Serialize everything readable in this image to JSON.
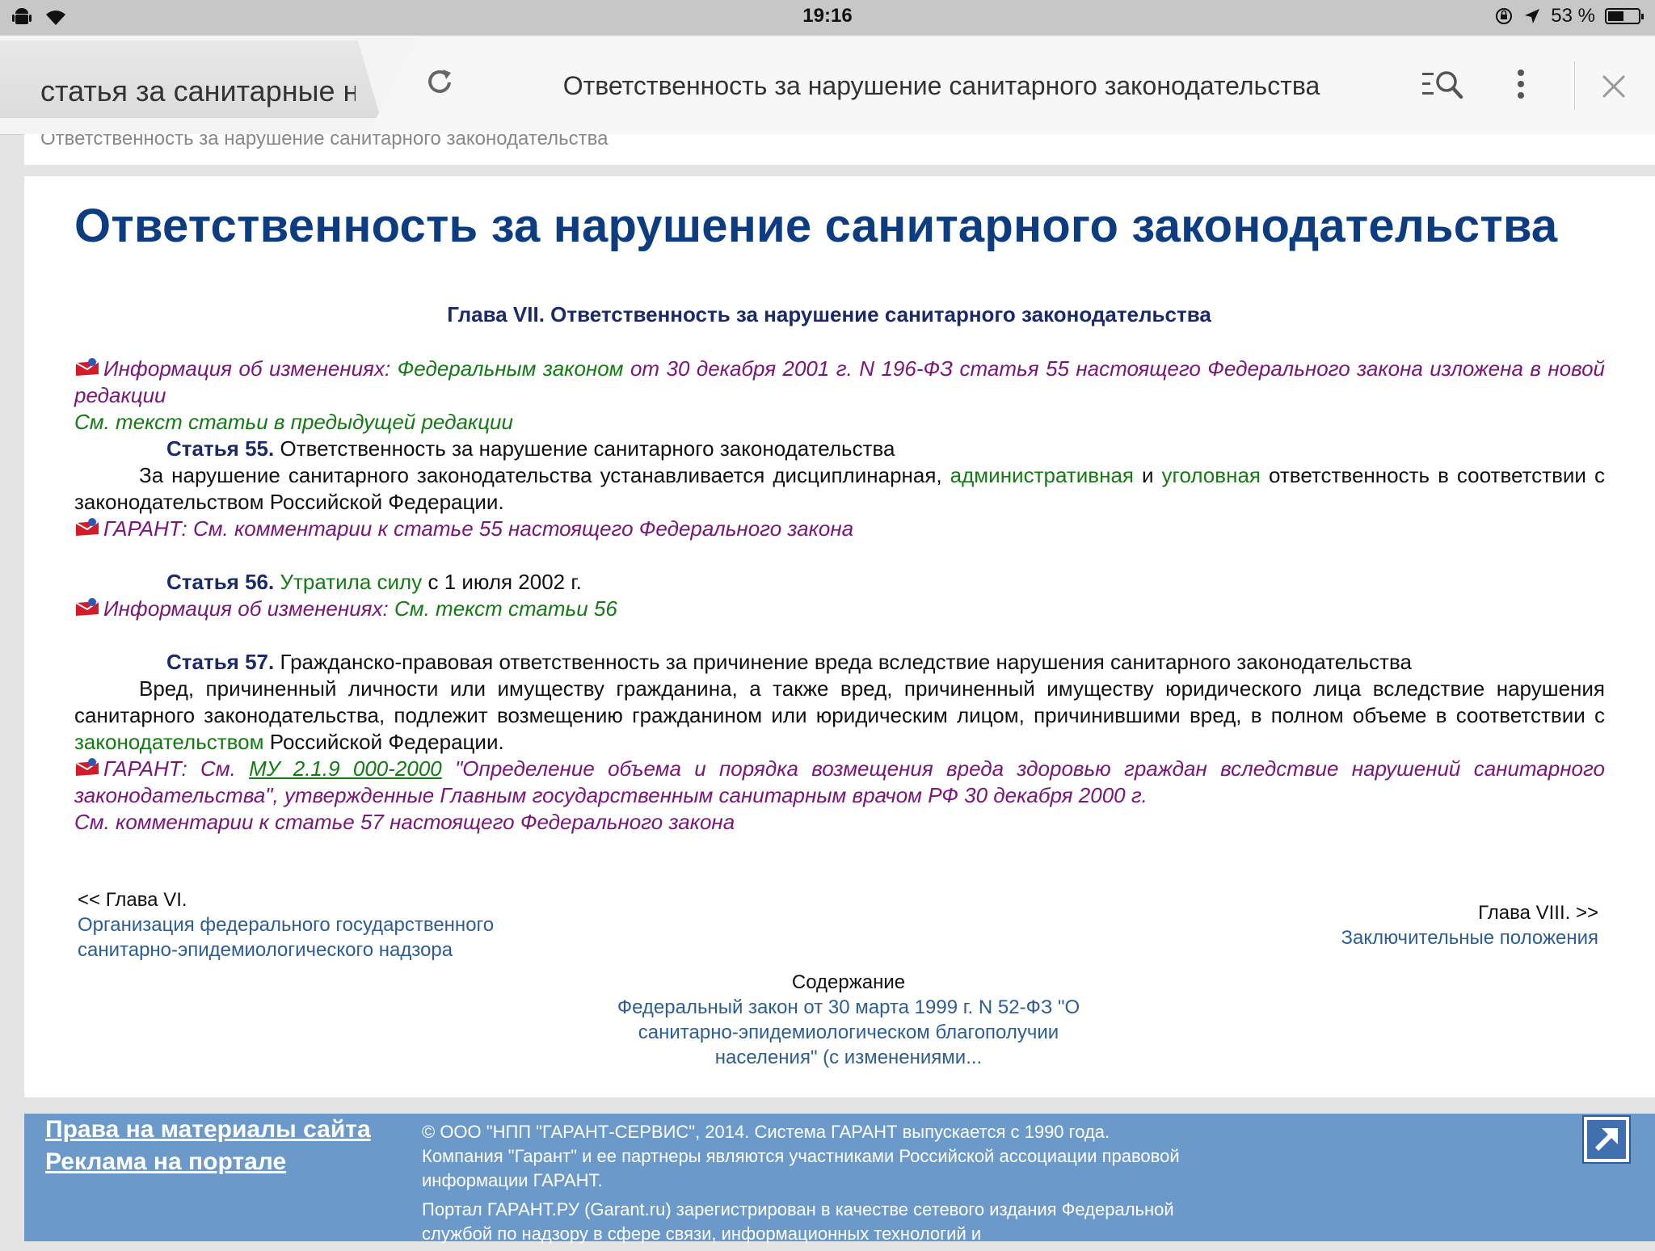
{
  "status_bar": {
    "time": "19:16",
    "battery_text": "53 %",
    "battery_level": 0.53,
    "icons": [
      "android-icon",
      "wifi-icon",
      "orientation-lock-icon",
      "location-arrow-icon",
      "battery-icon"
    ]
  },
  "browser": {
    "tab_inactive_title": "статья за санитарные н",
    "page_title": "Ответственность за нарушение санитарного законодательства",
    "icons": [
      "reload-icon",
      "find-in-page-icon",
      "more-vert-icon",
      "close-icon"
    ]
  },
  "breadcrumb": "Ответственность за нарушение санитарного законодательства",
  "article": {
    "heading": "Ответственность за нарушение санитарного законодательства",
    "chapter": "Глава VII. Ответственность за нарушение санитарного законодательства",
    "info1_label": "Информация об изменениях:",
    "info1_link": "Федеральным законом",
    "info1_text": "от 30 декабря 2001 г. N 196-ФЗ статья 55 настоящего Федерального закона изложена в новой редакции",
    "info1_prev": "См. текст статьи в предыдущей редакции",
    "art55_num": "Статья 55.",
    "art55_title": "Ответственность за нарушение санитарного законодательства",
    "art55_t1": "За нарушение санитарного законодательства устанавливается дисциплинарная,",
    "art55_link1": "административная",
    "art55_t2": "и",
    "art55_link2": "уголовная",
    "art55_t3": "ответственность в соответствии с законодательством Российской Федерации.",
    "garant1_label": "ГАРАНТ:",
    "garant1_text": "См. комментарии к статье 55 настоящего Федерального закона",
    "art56_num": "Статья 56.",
    "art56_link": "Утратила силу",
    "art56_text": "с 1 июля 2002 г.",
    "info2_label": "Информация об изменениях:",
    "info2_link": "См. текст статьи 56",
    "art57_num": "Статья 57.",
    "art57_title": "Гражданско-правовая ответственность за причинение вреда вследствие нарушения санитарного законодательства",
    "art57_t1": "Вред, причиненный личности или имуществу гражданина, а также вред, причиненный имуществу юридического лица вследствие нарушения санитарного законодательства, подлежит возмещению гражданином или юридическим лицом, причинившими вред, в полном объеме в соответствии с",
    "art57_link": "законодательством",
    "art57_t2": "Российской Федерации.",
    "garant2_label": "ГАРАНТ:",
    "garant2_see": "См.",
    "garant2_link": "МУ 2.1.9 000-2000",
    "garant2_text": "\"Определение объема и порядка возмещения вреда здоровью граждан вследствие нарушений санитарного законодательства\", утвержденные Главным государственным санитарным врачом РФ 30 декабря 2000 г.",
    "garant2_more": "См. комментарии к статье 57 настоящего Федерального закона"
  },
  "navigation": {
    "prev_label": "<< Глава VI.",
    "prev_link_line1": "Организация федерального государственного",
    "prev_link_line2": "санитарно-эпидемиологического надзора",
    "next_label": "Глава VIII.  >>",
    "next_link": "Заключительные положения",
    "contents_label": "Содержание",
    "contents_link_line1": "Федеральный закон от 30 марта 1999 г. N 52-ФЗ \"О",
    "contents_link_line2": "санитарно-эпидемиологическом благополучии",
    "contents_link_line3": "населения\" (с изменениями..."
  },
  "footer": {
    "link1": "Права на материалы сайта",
    "link2": "Реклама на портале",
    "copyright": "© ООО \"НПП \"ГАРАНТ-СЕРВИС\", 2014. Система ГАРАНТ выпускается с 1990 года. Компания \"Гарант\" и ее партнеры являются участниками Российской ассоциации правовой информации ГАРАНТ.",
    "portal": "Портал ГАРАНТ.РУ (Garant.ru) зарегистрирован в качестве сетевого издания Федеральной службой по надзору в сфере связи, информационных технологий и"
  }
}
